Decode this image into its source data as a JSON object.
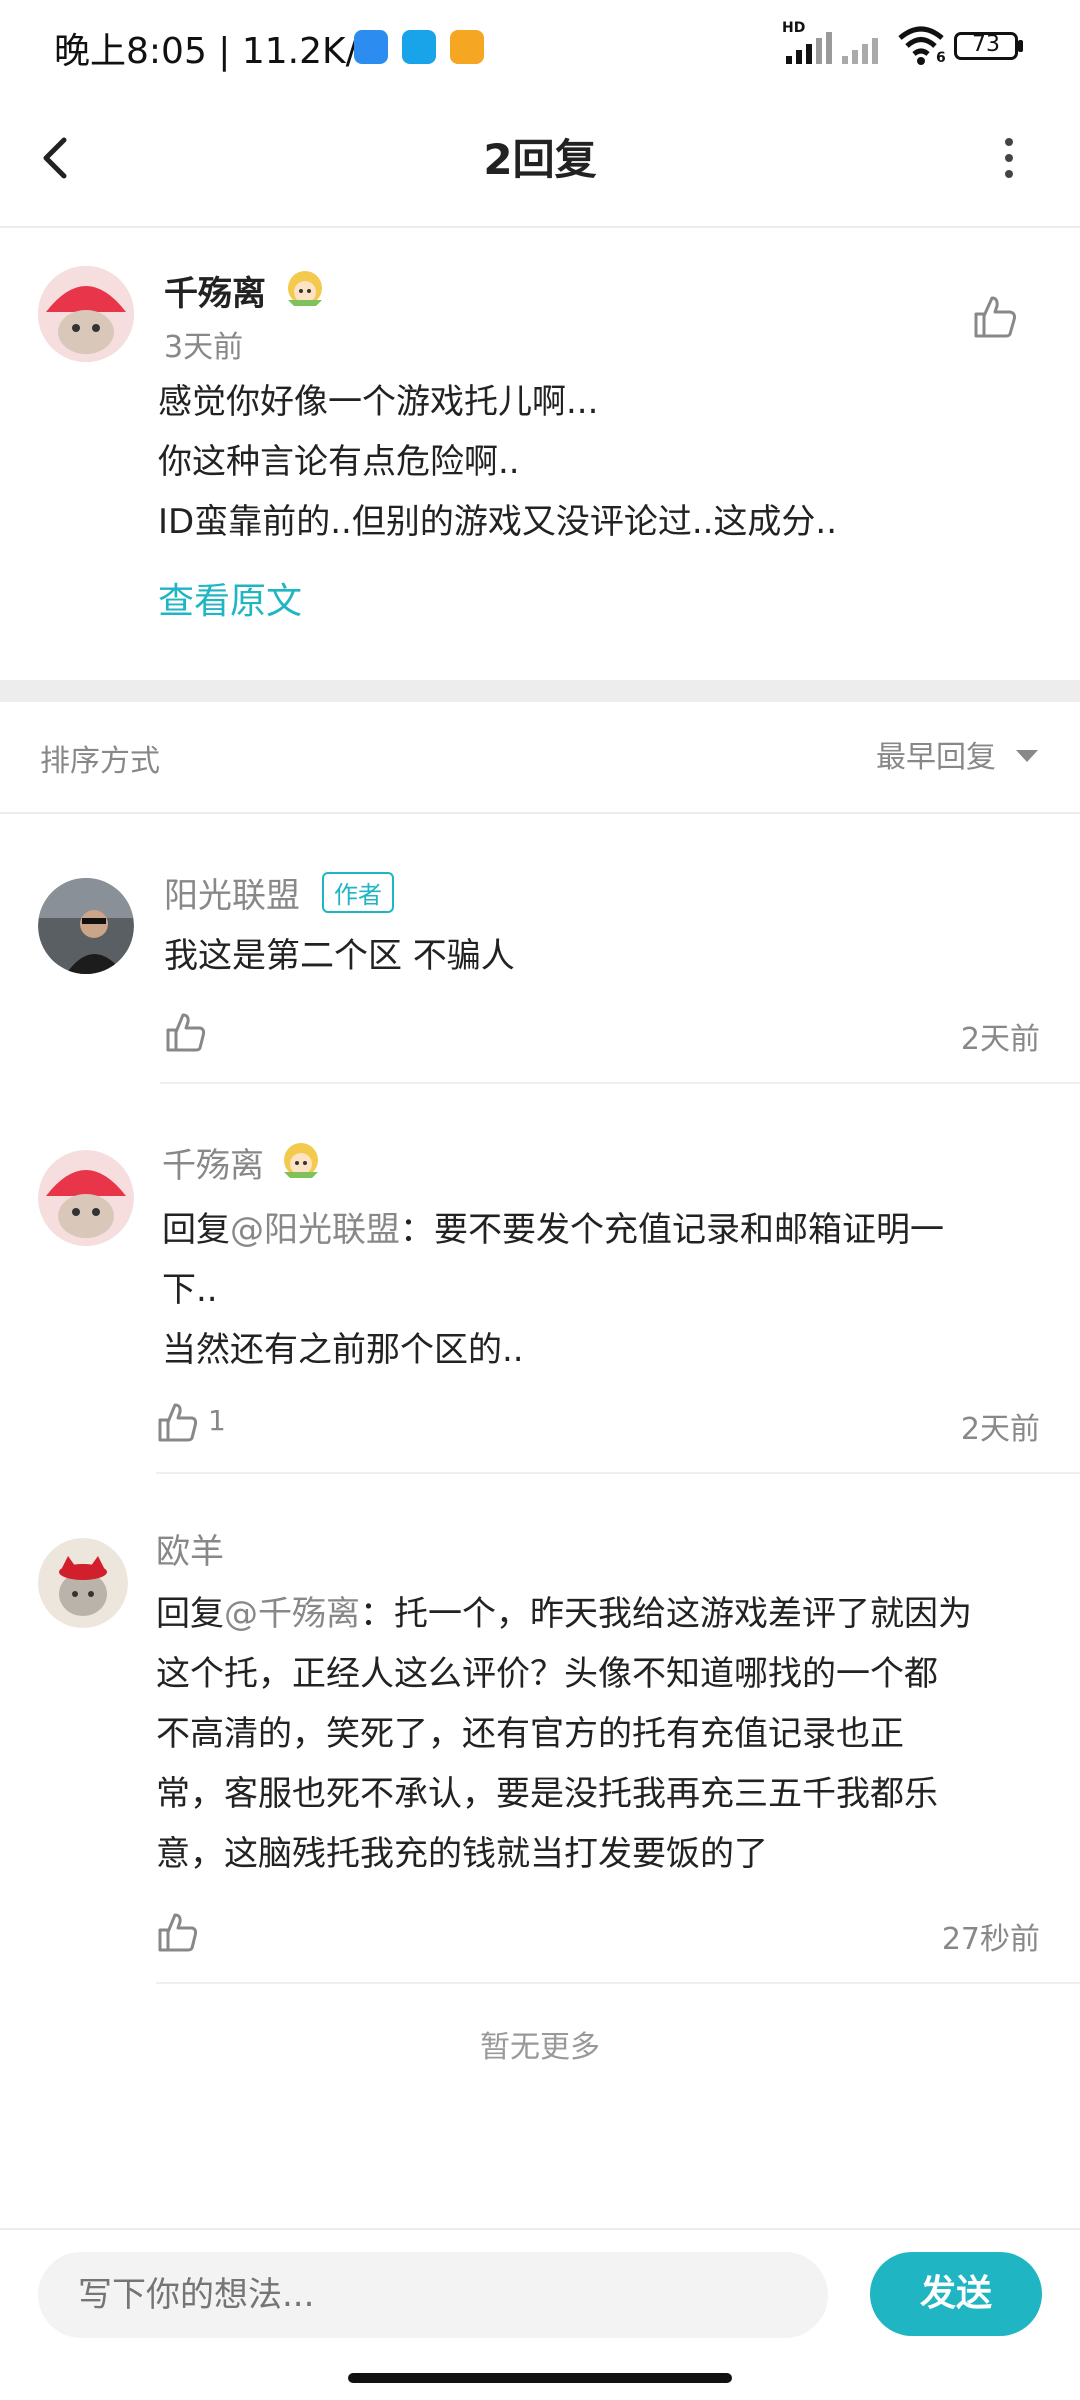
{
  "status_bar": {
    "time": "晚上8:05 | 11.2K/s",
    "battery": "73",
    "network_label": "HD",
    "wifi_label": "6"
  },
  "header": {
    "title": "2回复"
  },
  "original_post": {
    "username": "千殇离",
    "time": "3天前",
    "lines": [
      "感觉你好像一个游戏托儿啊...",
      "你这种言论有点危险啊..",
      "ID蛮靠前的..但别的游戏又没评论过..这成分.."
    ],
    "view_original": "查看原文"
  },
  "sort": {
    "label": "排序方式",
    "value": "最早回复"
  },
  "replies": [
    {
      "username": "阳光联盟",
      "tag": "作者",
      "text": "我这是第二个区  不骗人",
      "time": "2天前",
      "likes": ""
    },
    {
      "username": "千殇离",
      "reply_prefix": "回复",
      "mention": "@阳光联盟",
      "text_line1": "：要不要发个充值记录和邮箱证明一",
      "text_rest": [
        "下..",
        "当然还有之前那个区的.."
      ],
      "time": "2天前",
      "likes": "1"
    },
    {
      "username": "欧羊",
      "reply_prefix": "回复",
      "mention": "@千殇离",
      "text_line1": "：托一个，昨天我给这游戏差评了就因为",
      "text_rest": [
        "这个托，正经人这么评价？头像不知道哪找的一个都",
        "不高清的，笑死了，还有官方的托有充值记录也正",
        "常，客服也死不承认，要是没托我再充三五千我都乐",
        "意，这脑残托我充的钱就当打发要饭的了"
      ],
      "time": "27秒前",
      "likes": ""
    }
  ],
  "no_more": "暂无更多",
  "input": {
    "placeholder": "写下你的想法...",
    "send_label": "发送"
  },
  "colors": {
    "accent": "#1fb5c2",
    "text": "#222222",
    "muted": "#888888",
    "divider": "#ededed"
  }
}
